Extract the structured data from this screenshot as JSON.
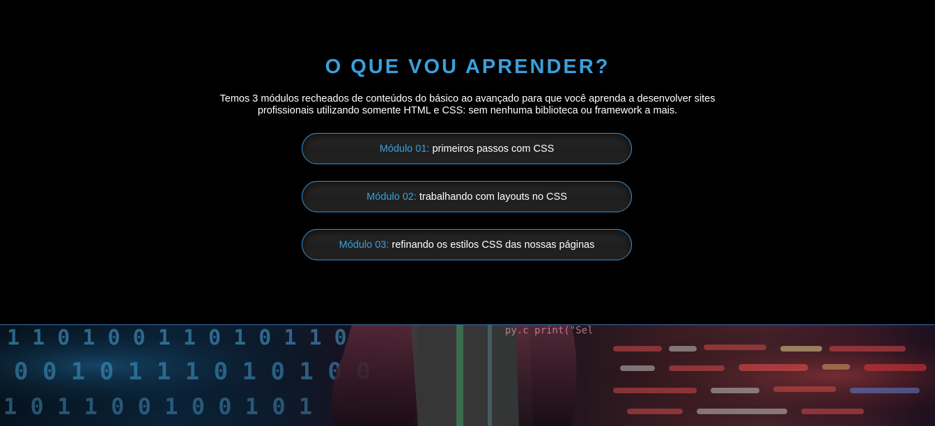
{
  "section": {
    "title": "O QUE VOU APRENDER?",
    "lead": "Temos 3 módulos recheados de conteúdos do básico ao avançado para que você aprenda a desenvolver sites profissionais utilizando somente HTML e CSS: sem nenhuma biblioteca ou framework a mais.",
    "modules": [
      {
        "number": "Módulo 01:",
        "label": "primeiros passos com CSS"
      },
      {
        "number": "Módulo 02:",
        "label": "trabalhando com layouts no CSS"
      },
      {
        "number": "Módulo 03:",
        "label": "refinando os estilos CSS das nossas páginas"
      }
    ]
  },
  "banner": {
    "binary_rows": [
      "1 1 0 1 0 0 1 1 0 1 0 1 1 0",
      "0 0 1 0 1 1 1 0 1 0 1 0 0",
      "1 0 1 1 0 0 1 0 0 1 0 1"
    ],
    "code_snippet": "py.c\nprint(\"Sel"
  },
  "colors": {
    "accent": "#3aa0dc",
    "module_border": "#3a8fd0",
    "background": "#000000",
    "text": "#ffffff"
  }
}
